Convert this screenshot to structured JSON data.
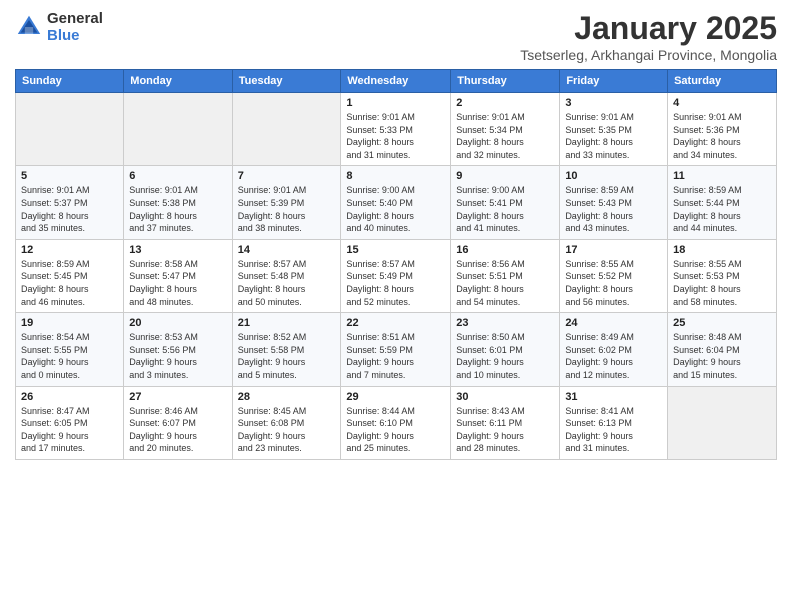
{
  "header": {
    "logo_line1": "General",
    "logo_line2": "Blue",
    "month": "January 2025",
    "location": "Tsetserleg, Arkhangai Province, Mongolia"
  },
  "weekdays": [
    "Sunday",
    "Monday",
    "Tuesday",
    "Wednesday",
    "Thursday",
    "Friday",
    "Saturday"
  ],
  "weeks": [
    [
      {
        "day": "",
        "info": ""
      },
      {
        "day": "",
        "info": ""
      },
      {
        "day": "",
        "info": ""
      },
      {
        "day": "1",
        "info": "Sunrise: 9:01 AM\nSunset: 5:33 PM\nDaylight: 8 hours\nand 31 minutes."
      },
      {
        "day": "2",
        "info": "Sunrise: 9:01 AM\nSunset: 5:34 PM\nDaylight: 8 hours\nand 32 minutes."
      },
      {
        "day": "3",
        "info": "Sunrise: 9:01 AM\nSunset: 5:35 PM\nDaylight: 8 hours\nand 33 minutes."
      },
      {
        "day": "4",
        "info": "Sunrise: 9:01 AM\nSunset: 5:36 PM\nDaylight: 8 hours\nand 34 minutes."
      }
    ],
    [
      {
        "day": "5",
        "info": "Sunrise: 9:01 AM\nSunset: 5:37 PM\nDaylight: 8 hours\nand 35 minutes."
      },
      {
        "day": "6",
        "info": "Sunrise: 9:01 AM\nSunset: 5:38 PM\nDaylight: 8 hours\nand 37 minutes."
      },
      {
        "day": "7",
        "info": "Sunrise: 9:01 AM\nSunset: 5:39 PM\nDaylight: 8 hours\nand 38 minutes."
      },
      {
        "day": "8",
        "info": "Sunrise: 9:00 AM\nSunset: 5:40 PM\nDaylight: 8 hours\nand 40 minutes."
      },
      {
        "day": "9",
        "info": "Sunrise: 9:00 AM\nSunset: 5:41 PM\nDaylight: 8 hours\nand 41 minutes."
      },
      {
        "day": "10",
        "info": "Sunrise: 8:59 AM\nSunset: 5:43 PM\nDaylight: 8 hours\nand 43 minutes."
      },
      {
        "day": "11",
        "info": "Sunrise: 8:59 AM\nSunset: 5:44 PM\nDaylight: 8 hours\nand 44 minutes."
      }
    ],
    [
      {
        "day": "12",
        "info": "Sunrise: 8:59 AM\nSunset: 5:45 PM\nDaylight: 8 hours\nand 46 minutes."
      },
      {
        "day": "13",
        "info": "Sunrise: 8:58 AM\nSunset: 5:47 PM\nDaylight: 8 hours\nand 48 minutes."
      },
      {
        "day": "14",
        "info": "Sunrise: 8:57 AM\nSunset: 5:48 PM\nDaylight: 8 hours\nand 50 minutes."
      },
      {
        "day": "15",
        "info": "Sunrise: 8:57 AM\nSunset: 5:49 PM\nDaylight: 8 hours\nand 52 minutes."
      },
      {
        "day": "16",
        "info": "Sunrise: 8:56 AM\nSunset: 5:51 PM\nDaylight: 8 hours\nand 54 minutes."
      },
      {
        "day": "17",
        "info": "Sunrise: 8:55 AM\nSunset: 5:52 PM\nDaylight: 8 hours\nand 56 minutes."
      },
      {
        "day": "18",
        "info": "Sunrise: 8:55 AM\nSunset: 5:53 PM\nDaylight: 8 hours\nand 58 minutes."
      }
    ],
    [
      {
        "day": "19",
        "info": "Sunrise: 8:54 AM\nSunset: 5:55 PM\nDaylight: 9 hours\nand 0 minutes."
      },
      {
        "day": "20",
        "info": "Sunrise: 8:53 AM\nSunset: 5:56 PM\nDaylight: 9 hours\nand 3 minutes."
      },
      {
        "day": "21",
        "info": "Sunrise: 8:52 AM\nSunset: 5:58 PM\nDaylight: 9 hours\nand 5 minutes."
      },
      {
        "day": "22",
        "info": "Sunrise: 8:51 AM\nSunset: 5:59 PM\nDaylight: 9 hours\nand 7 minutes."
      },
      {
        "day": "23",
        "info": "Sunrise: 8:50 AM\nSunset: 6:01 PM\nDaylight: 9 hours\nand 10 minutes."
      },
      {
        "day": "24",
        "info": "Sunrise: 8:49 AM\nSunset: 6:02 PM\nDaylight: 9 hours\nand 12 minutes."
      },
      {
        "day": "25",
        "info": "Sunrise: 8:48 AM\nSunset: 6:04 PM\nDaylight: 9 hours\nand 15 minutes."
      }
    ],
    [
      {
        "day": "26",
        "info": "Sunrise: 8:47 AM\nSunset: 6:05 PM\nDaylight: 9 hours\nand 17 minutes."
      },
      {
        "day": "27",
        "info": "Sunrise: 8:46 AM\nSunset: 6:07 PM\nDaylight: 9 hours\nand 20 minutes."
      },
      {
        "day": "28",
        "info": "Sunrise: 8:45 AM\nSunset: 6:08 PM\nDaylight: 9 hours\nand 23 minutes."
      },
      {
        "day": "29",
        "info": "Sunrise: 8:44 AM\nSunset: 6:10 PM\nDaylight: 9 hours\nand 25 minutes."
      },
      {
        "day": "30",
        "info": "Sunrise: 8:43 AM\nSunset: 6:11 PM\nDaylight: 9 hours\nand 28 minutes."
      },
      {
        "day": "31",
        "info": "Sunrise: 8:41 AM\nSunset: 6:13 PM\nDaylight: 9 hours\nand 31 minutes."
      },
      {
        "day": "",
        "info": ""
      }
    ]
  ]
}
